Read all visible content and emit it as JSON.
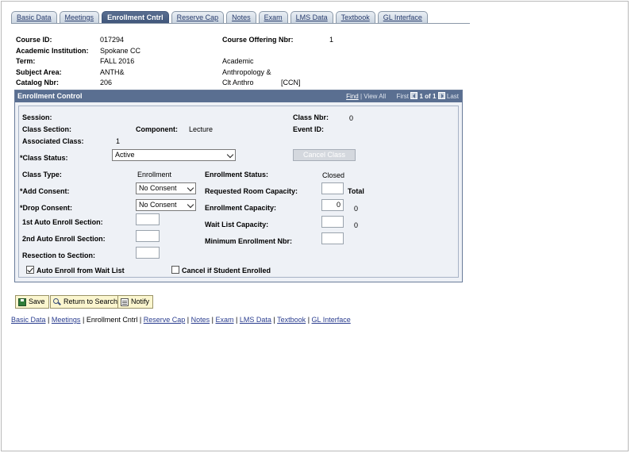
{
  "tabs": [
    {
      "label": "Basic Data",
      "active": false
    },
    {
      "label": "Meetings",
      "active": false
    },
    {
      "label": "Enrollment Cntrl",
      "active": true
    },
    {
      "label": "Reserve Cap",
      "active": false
    },
    {
      "label": "Notes",
      "active": false
    },
    {
      "label": "Exam",
      "active": false
    },
    {
      "label": "LMS Data",
      "active": false
    },
    {
      "label": "Textbook",
      "active": false
    },
    {
      "label": "GL Interface",
      "active": false
    }
  ],
  "course": {
    "course_id_label": "Course ID:",
    "course_id": "017294",
    "offering_label": "Course Offering Nbr:",
    "offering": "1",
    "institution_label": "Academic Institution:",
    "institution": "Spokane CC",
    "term_label": "Term:",
    "term": "FALL 2016",
    "term_desc": "Academic",
    "subject_label": "Subject Area:",
    "subject": "ANTH&",
    "subject_desc": "Anthropology &",
    "catalog_label": "Catalog Nbr:",
    "catalog": "206",
    "catalog_desc": "Clt Anthro",
    "catalog_ccn": "[CCN]"
  },
  "enrollment_control": {
    "title": "Enrollment Control",
    "nav": {
      "find": "Find",
      "view_all": "View All",
      "first": "First",
      "count": "1 of 1",
      "last": "Last",
      "sep": "|"
    },
    "session_label": "Session:",
    "class_nbr_label": "Class Nbr:",
    "class_nbr": "0",
    "class_section_label": "Class Section:",
    "component_label": "Component:",
    "component": "Lecture",
    "event_id_label": "Event ID:",
    "assoc_class_label": "Associated Class:",
    "assoc_class": "1",
    "class_status_label": "*Class Status:",
    "class_status": "Active",
    "cancel_class_label": "Cancel Class",
    "class_type_label": "Class Type:",
    "class_type": "Enrollment",
    "enroll_status_label": "Enrollment Status:",
    "enroll_status": "Closed",
    "add_consent_label": "*Add Consent:",
    "add_consent": "No Consent",
    "room_cap_label": "Requested Room Capacity:",
    "room_cap": "",
    "total_label": "Total",
    "drop_consent_label": "*Drop Consent:",
    "drop_consent": "No Consent",
    "enroll_cap_label": "Enrollment Capacity:",
    "enroll_cap": "0",
    "enroll_total": "0",
    "auto_enroll_1_label": "1st Auto Enroll Section:",
    "auto_enroll_1": "",
    "wait_cap_label": "Wait List Capacity:",
    "wait_cap": "",
    "wait_total": "0",
    "auto_enroll_2_label": "2nd Auto Enroll Section:",
    "auto_enroll_2": "",
    "min_enroll_label": "Minimum Enrollment Nbr:",
    "min_enroll": "",
    "resection_label": "Resection to Section:",
    "resection": "",
    "auto_enroll_wait_label": "Auto Enroll from Wait List",
    "auto_enroll_wait_checked": true,
    "cancel_if_enrolled_label": "Cancel if Student Enrolled",
    "cancel_if_enrolled_checked": false
  },
  "toolbar": {
    "save_label": "Save",
    "return_label": "Return to Search",
    "notify_label": "Notify"
  },
  "bottom_links": {
    "basic_data": "Basic Data",
    "meetings": "Meetings",
    "enrollment_cntrl": "Enrollment Cntrl",
    "reserve_cap": "Reserve Cap",
    "notes": "Notes",
    "exam": "Exam",
    "lms_data": "LMS Data",
    "textbook": "Textbook",
    "gl_interface": "GL Interface",
    "sep": "|"
  },
  "colors": {
    "header_bar": "#5a6f91",
    "panel_bg": "#eef1f6",
    "toolbar_button_bg": "#fbf6cf",
    "link": "#2a3d8f"
  }
}
